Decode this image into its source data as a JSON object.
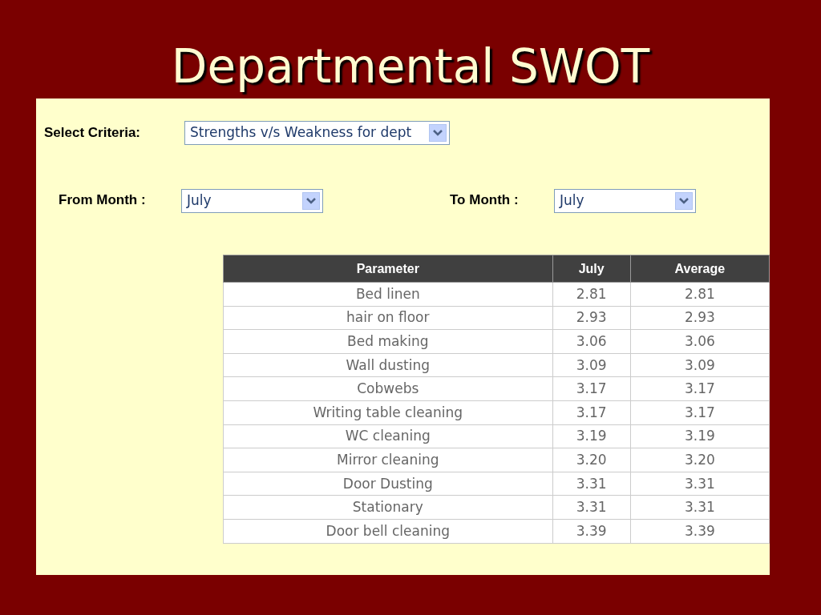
{
  "title": "Departmental SWOT",
  "criteria": {
    "label": "Select Criteria:",
    "value": "Strengths v/s Weakness for dept"
  },
  "from_month": {
    "label": "From Month :",
    "value": "July"
  },
  "to_month": {
    "label": "To Month :",
    "value": "July"
  },
  "table": {
    "columns": [
      "Parameter",
      "July",
      "Average"
    ],
    "rows": [
      [
        "Bed linen",
        "2.81",
        "2.81"
      ],
      [
        "hair on floor",
        "2.93",
        "2.93"
      ],
      [
        "Bed making",
        "3.06",
        "3.06"
      ],
      [
        "Wall dusting",
        "3.09",
        "3.09"
      ],
      [
        "Cobwebs",
        "3.17",
        "3.17"
      ],
      [
        "Writing table cleaning",
        "3.17",
        "3.17"
      ],
      [
        "WC cleaning",
        "3.19",
        "3.19"
      ],
      [
        "Mirror cleaning",
        "3.20",
        "3.20"
      ],
      [
        "Door Dusting",
        "3.31",
        "3.31"
      ],
      [
        "Stationary",
        "3.31",
        "3.31"
      ],
      [
        "Door bell cleaning",
        "3.39",
        "3.39"
      ]
    ]
  }
}
